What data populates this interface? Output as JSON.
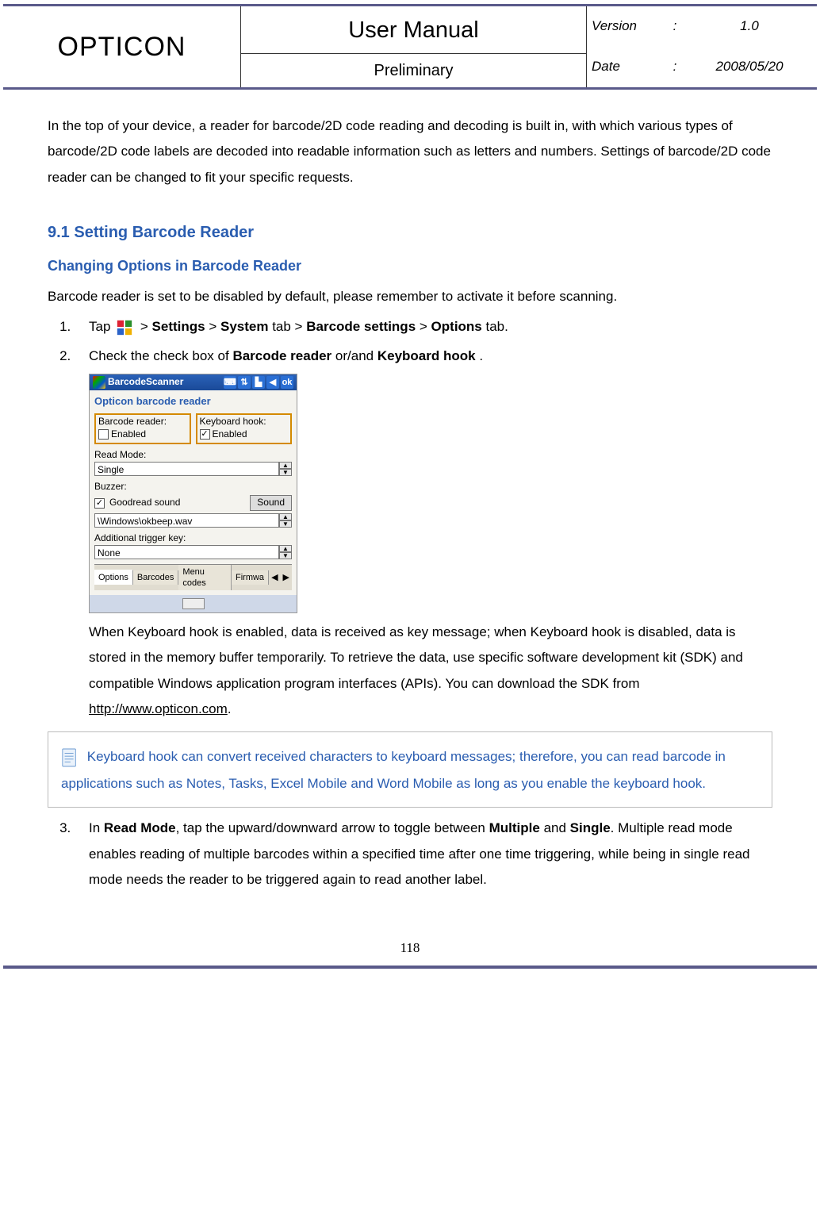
{
  "header": {
    "brand": "OPTICON",
    "title": "User Manual",
    "subtitle": "Preliminary",
    "version_label": "Version",
    "version_value": "1.0",
    "date_label": "Date",
    "date_value": "2008/05/20"
  },
  "intro": "In the top of your device, a reader for barcode/2D code reading and decoding is built in, with which various types of barcode/2D code labels are decoded into readable information such as letters and numbers. Settings of barcode/2D code reader can be changed to fit your specific requests.",
  "section_heading": "9.1 Setting Barcode Reader",
  "sub_heading": "Changing Options in Barcode Reader",
  "p_intro": "Barcode reader is set to be disabled by default, please remember to activate it before scanning.",
  "step1": {
    "prefix": "Tap ",
    "after_icon": " > ",
    "settings": "Settings",
    "sep1": " > ",
    "system": "System",
    "tab_word1": " tab > ",
    "barcode_settings": "Barcode settings",
    "sep2": " > ",
    "options": "Options",
    "tab_word2": " tab."
  },
  "step2": {
    "prefix": "Check the check box of ",
    "barcode_reader": "Barcode reader",
    "mid": " or/and ",
    "keyboard_hook": "Keyboard hook",
    "suffix": "."
  },
  "screenshot": {
    "title": "BarcodeScanner",
    "ok": "ok",
    "subtitle": "Opticon barcode reader",
    "barcode_reader_label": "Barcode reader:",
    "barcode_reader_enabled": "Enabled",
    "barcode_reader_checked": false,
    "keyboard_hook_label": "Keyboard hook:",
    "keyboard_hook_enabled": "Enabled",
    "keyboard_hook_checked": true,
    "read_mode_label": "Read Mode:",
    "read_mode_value": "Single",
    "buzzer_label": "Buzzer:",
    "buzzer_chk_label": "Goodread sound",
    "buzzer_checked": true,
    "sound_button": "Sound",
    "sound_path": "\\Windows\\okbeep.wav",
    "trigger_label": "Additional trigger key:",
    "trigger_value": "None",
    "tabs": [
      "Options",
      "Barcodes",
      "Menu codes",
      "Firmwa"
    ]
  },
  "after_ss": {
    "text_a": "When Keyboard hook is enabled, data is received as key message; when Keyboard hook is disabled, data is stored in the memory buffer temporarily. To retrieve the data, use specific software development kit (SDK) and compatible Windows application program interfaces (APIs). You can download the SDK from ",
    "link": "http://www.opticon.com",
    "text_b": "."
  },
  "note": "Keyboard hook can convert received characters to keyboard messages; therefore, you can read barcode in applications such as Notes, Tasks, Excel Mobile and Word Mobile as long as you enable the keyboard hook.",
  "step3": {
    "a": "In ",
    "read_mode": "Read Mode",
    "b": ", tap the upward/downward arrow to toggle between ",
    "multiple": "Multiple",
    "c": " and ",
    "single": "Single",
    "d": ". Multiple read mode enables reading of multiple barcodes within a specified time after one time triggering, while being in single read mode needs the reader to be triggered again to read another label."
  },
  "page_number": "118"
}
